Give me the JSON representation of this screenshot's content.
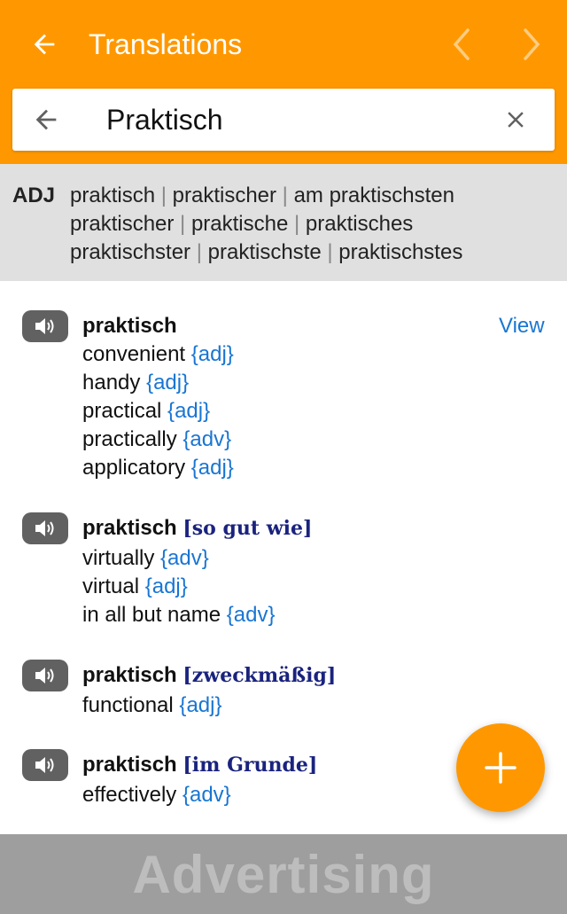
{
  "header": {
    "title": "Translations",
    "color": "#FF9800"
  },
  "search": {
    "value": "Praktisch"
  },
  "inflection": {
    "pos": "ADJ",
    "lines": [
      [
        "praktisch",
        "praktischer",
        "am praktischsten"
      ],
      [
        "praktischer",
        "praktische",
        "praktisches"
      ],
      [
        "praktischster",
        "praktischste",
        "praktischstes"
      ]
    ],
    "separator": "|"
  },
  "entries": [
    {
      "word": "praktisch",
      "qualifier": "",
      "view_label": "View",
      "translations": [
        {
          "text": "convenient",
          "tag": "{adj}"
        },
        {
          "text": "handy",
          "tag": "{adj}"
        },
        {
          "text": "practical",
          "tag": "{adj}"
        },
        {
          "text": "practically",
          "tag": "{adv}"
        },
        {
          "text": "applicatory",
          "tag": "{adj}"
        }
      ]
    },
    {
      "word": "praktisch",
      "qualifier": "[so gut wie]",
      "translations": [
        {
          "text": "virtually",
          "tag": "{adv}"
        },
        {
          "text": "virtual",
          "tag": "{adj}"
        },
        {
          "text": "in all but name",
          "tag": "{adv}"
        }
      ]
    },
    {
      "word": "praktisch",
      "qualifier": "[zweckmäßig]",
      "translations": [
        {
          "text": "functional",
          "tag": "{adj}"
        }
      ]
    },
    {
      "word": "praktisch",
      "qualifier": "[im Grunde]",
      "translations": [
        {
          "text": "effectively",
          "tag": "{adv}"
        }
      ]
    }
  ],
  "ad": {
    "label": "Advertising"
  },
  "icons": {
    "back": "arrow-left-icon",
    "prev": "chevron-left-icon",
    "next": "chevron-right-icon",
    "clear": "close-icon",
    "speaker": "speaker-icon",
    "fab": "plus-icon"
  }
}
